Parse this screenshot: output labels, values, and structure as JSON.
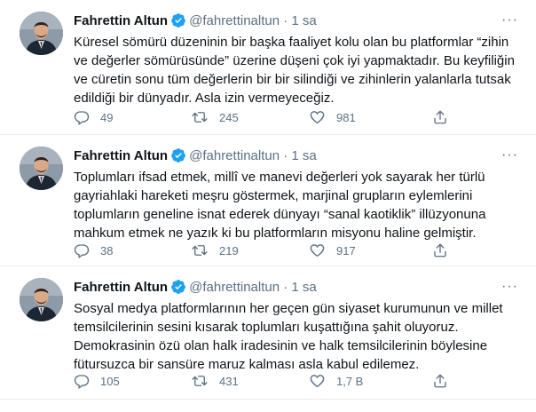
{
  "tweets": [
    {
      "author": "Fahrettin Altun",
      "handle": "@fahrettinaltun",
      "separator": "·",
      "time": "1 sa",
      "more": "···",
      "text": "Küresel sömürü düzeninin bir başka faaliyet kolu olan bu platformlar “zihin ve değerler sömürüsünde” üzerine düşeni çok iyi yapmaktadır. Bu keyfiliğin ve cüretin sonu tüm değerlerin bir bir silindiği ve zihinlerin yalanlarla tutsak edildiği bir dünyadır. Asla izin vermeyeceğiz.",
      "replies": "49",
      "retweets": "245",
      "likes": "981"
    },
    {
      "author": "Fahrettin Altun",
      "handle": "@fahrettinaltun",
      "separator": "·",
      "time": "1 sa",
      "more": "···",
      "text": "Toplumları ifsad etmek, millî ve manevi değerleri yok sayarak her türlü gayriahlaki hareketi meşru göstermek, marjinal grupların eylemlerini toplumların geneline isnat ederek dünyayı “sanal kaotiklik” illüzyonuna mahkum etmek ne yazık ki bu platformların misyonu haline gelmiştir.",
      "replies": "38",
      "retweets": "219",
      "likes": "917"
    },
    {
      "author": "Fahrettin Altun",
      "handle": "@fahrettinaltun",
      "separator": "·",
      "time": "1 sa",
      "more": "···",
      "text": "Sosyal medya platformlarının her geçen gün siyaset kurumunun ve millet temsilcilerinin sesini kısarak toplumları kuşattığına şahit oluyoruz. Demokrasinin özü olan halk iradesinin ve halk temsilcilerinin böylesine fütursuzca bir sansüre maruz kalması asla kabul edilemez.",
      "replies": "105",
      "retweets": "431",
      "likes": "1,7 B"
    }
  ],
  "icons": {
    "verified": "verified-badge-icon",
    "reply": "reply-icon",
    "retweet": "retweet-icon",
    "like": "heart-icon",
    "share": "share-icon"
  },
  "colors": {
    "text": "#0f1419",
    "muted": "#5b7083",
    "verified": "#1da1f2",
    "border": "#e6ecf0"
  }
}
